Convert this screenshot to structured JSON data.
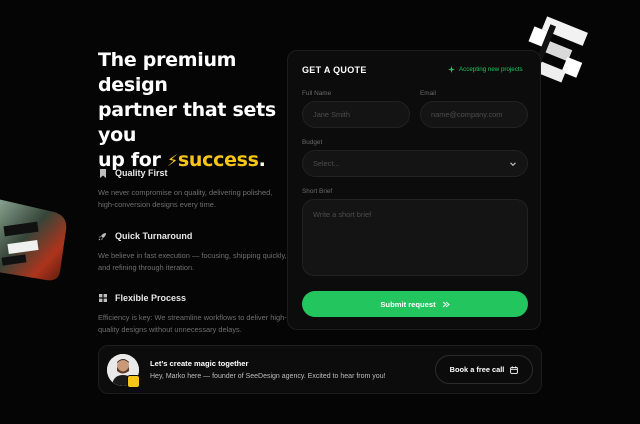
{
  "hero": {
    "line1": "The premium design",
    "line2": "partner that sets you",
    "line3_prefix": "up for",
    "accent": "success",
    "suffix": "."
  },
  "features": [
    {
      "icon": "bookmark-icon",
      "title": "Quality First",
      "desc": "We never compromise on quality, delivering polished, high-conversion designs every time."
    },
    {
      "icon": "rocket-icon",
      "title": "Quick Turnaround",
      "desc": "We believe in fast execution — focusing, shipping quickly, and refining through iteration."
    },
    {
      "icon": "grid-icon",
      "title": "Flexible Process",
      "desc": "Efficiency is key: We streamline workflows to deliver high-quality designs without unnecessary delays."
    }
  ],
  "form": {
    "title": "GET A QUOTE",
    "status": "Accepting new projects",
    "full_name_label": "Full Name",
    "full_name_placeholder": "Jane Smith",
    "email_label": "Email",
    "email_placeholder": "name@company.com",
    "budget_label": "Budget",
    "budget_placeholder": "Select...",
    "brief_label": "Short Brief",
    "brief_placeholder": "Write a short brief",
    "submit_label": "Submit request"
  },
  "footer": {
    "title": "Let’s create magic together",
    "subtitle": "Hey, Marko here — founder of SeeDesign agency. Excited to hear from you!",
    "book_label": "Book a free call"
  },
  "colors": {
    "background": "#050505",
    "accent_yellow": "#f5c518",
    "accent_green": "#22c55e"
  }
}
